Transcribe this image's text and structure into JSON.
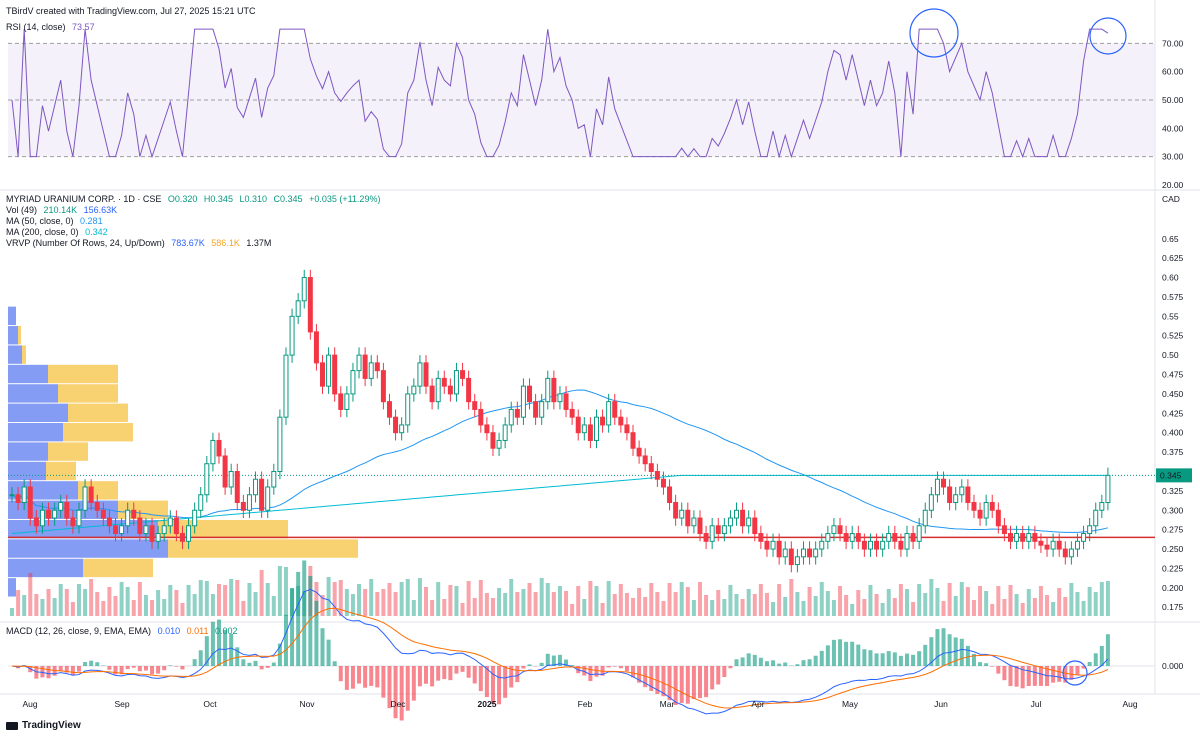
{
  "header": {
    "credit": "TBirdV created with TradingView.com, Jul 27, 2025 15:21 UTC"
  },
  "rsi": {
    "label": "RSI (14, close)",
    "value": "73.57",
    "levels": [
      "70.00",
      "60.00",
      "50.00",
      "40.00",
      "30.00",
      "20.00"
    ]
  },
  "main": {
    "title": "MYRIAD URANIUM CORP. · 1D · CSE",
    "o": "O0.320",
    "h": "H0.345",
    "l": "L0.310",
    "c": "C0.345",
    "chg": "+0.035 (+11.29%)",
    "vol_label": "Vol (49)",
    "vol_v1": "210.14K",
    "vol_v2": "156.63K",
    "ma50_label": "MA (50, close, 0)",
    "ma50_val": "0.281",
    "ma200_label": "MA (200, close, 0)",
    "ma200_val": "0.342",
    "vrvp_label": "VRVP (Number Of Rows, 24, Up/Down)",
    "vrvp_up": "783.67K",
    "vrvp_down": "586.1K",
    "vrvp_total": "1.37M",
    "currency": "CAD",
    "last_price": "0.345",
    "price_levels": [
      "0.65",
      "0.625",
      "0.60",
      "0.575",
      "0.55",
      "0.525",
      "0.50",
      "0.475",
      "0.450",
      "0.425",
      "0.400",
      "0.375",
      "0.350",
      "0.325",
      "0.300",
      "0.275",
      "0.250",
      "0.225",
      "0.200",
      "0.175"
    ]
  },
  "macd": {
    "label": "MACD (12, 26, close, 9, EMA, EMA)",
    "v1": "0.010",
    "v2": "0.011",
    "v3": "0.002",
    "levels": [
      "0.000"
    ]
  },
  "time_axis": [
    "Aug",
    "Sep",
    "Oct",
    "Nov",
    "Dec",
    "2025",
    "Feb",
    "Mar",
    "Apr",
    "May",
    "Jun",
    "Jul",
    "Aug"
  ],
  "brand": "TradingView",
  "colors": {
    "up": "#089981",
    "down": "#f23645",
    "rsi": "#7e57c2",
    "ma50": "#2196f3",
    "ma200": "#00bcd4",
    "hline": "#d32f2f",
    "vp_up": "#5b7bf0",
    "vp_down": "#f5c242"
  },
  "chart_data": {
    "type": "candlestick",
    "title": "MYRIAD URANIUM CORP. · 1D · CSE",
    "ylim": [
      0.165,
      0.66
    ],
    "support_line": 0.265,
    "last_close": 0.345,
    "x_ticks": [
      "Aug",
      "Sep",
      "Oct",
      "Nov",
      "Dec",
      "2025",
      "Feb",
      "Mar",
      "Apr",
      "May",
      "Jun",
      "Jul",
      "Aug"
    ],
    "closes": [
      0.32,
      0.31,
      0.33,
      0.29,
      0.28,
      0.3,
      0.29,
      0.3,
      0.31,
      0.29,
      0.28,
      0.3,
      0.33,
      0.31,
      0.3,
      0.29,
      0.28,
      0.27,
      0.28,
      0.3,
      0.29,
      0.27,
      0.28,
      0.26,
      0.27,
      0.28,
      0.29,
      0.27,
      0.26,
      0.28,
      0.3,
      0.32,
      0.36,
      0.39,
      0.37,
      0.33,
      0.35,
      0.31,
      0.3,
      0.32,
      0.34,
      0.3,
      0.33,
      0.35,
      0.42,
      0.5,
      0.55,
      0.57,
      0.6,
      0.53,
      0.49,
      0.46,
      0.5,
      0.45,
      0.43,
      0.45,
      0.48,
      0.5,
      0.47,
      0.49,
      0.48,
      0.44,
      0.42,
      0.4,
      0.41,
      0.45,
      0.46,
      0.49,
      0.46,
      0.44,
      0.47,
      0.46,
      0.45,
      0.48,
      0.47,
      0.44,
      0.43,
      0.41,
      0.4,
      0.38,
      0.39,
      0.41,
      0.43,
      0.42,
      0.46,
      0.44,
      0.42,
      0.44,
      0.47,
      0.44,
      0.45,
      0.43,
      0.42,
      0.4,
      0.41,
      0.39,
      0.42,
      0.41,
      0.44,
      0.42,
      0.41,
      0.4,
      0.38,
      0.37,
      0.36,
      0.35,
      0.34,
      0.33,
      0.31,
      0.29,
      0.3,
      0.28,
      0.29,
      0.27,
      0.26,
      0.28,
      0.27,
      0.28,
      0.29,
      0.3,
      0.28,
      0.29,
      0.27,
      0.26,
      0.25,
      0.26,
      0.24,
      0.25,
      0.23,
      0.24,
      0.25,
      0.24,
      0.25,
      0.26,
      0.27,
      0.28,
      0.27,
      0.26,
      0.27,
      0.26,
      0.25,
      0.26,
      0.25,
      0.26,
      0.27,
      0.26,
      0.25,
      0.27,
      0.26,
      0.28,
      0.3,
      0.32,
      0.34,
      0.33,
      0.31,
      0.32,
      0.33,
      0.31,
      0.3,
      0.29,
      0.31,
      0.3,
      0.28,
      0.27,
      0.26,
      0.27,
      0.26,
      0.27,
      0.26,
      0.255,
      0.25,
      0.26,
      0.25,
      0.24,
      0.25,
      0.26,
      0.27,
      0.28,
      0.3,
      0.31,
      0.345
    ],
    "volume_axis_note": "volume bars scaled beneath price",
    "rsi_ylim": [
      20,
      80
    ],
    "rsi_last": 73.57,
    "macd_last": [
      0.01,
      0.011,
      0.002
    ]
  }
}
